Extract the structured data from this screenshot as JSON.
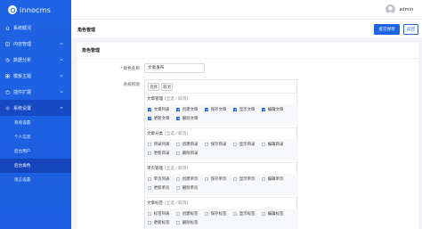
{
  "brand": {
    "name": "innocms"
  },
  "sidebar": {
    "items": [
      {
        "label": "系统概况",
        "icon": "home-icon",
        "has_children": false
      },
      {
        "label": "内容管理",
        "icon": "content-icon",
        "has_children": true
      },
      {
        "label": "数据分析",
        "icon": "chart-icon",
        "has_children": true
      },
      {
        "label": "模板主题",
        "icon": "theme-icon",
        "has_children": true
      },
      {
        "label": "插件扩展",
        "icon": "plugin-icon",
        "has_children": true
      },
      {
        "label": "系统设置",
        "icon": "gear-icon",
        "has_children": true,
        "expanded": true
      }
    ],
    "subitems": [
      {
        "label": "系统设置"
      },
      {
        "label": "个人信息"
      },
      {
        "label": "后台用户"
      },
      {
        "label": "后台角色",
        "active": true
      },
      {
        "label": "语言设置"
      }
    ]
  },
  "topbar": {
    "user": "admin"
  },
  "header": {
    "title": "角色管理",
    "save_label": "提交保存",
    "back_label": "返回"
  },
  "form": {
    "card_title": "角色管理",
    "name_label": "角色名称",
    "name_required": "*",
    "name_value": "文章发布",
    "perm_label": "系统权限",
    "select_all": "选择",
    "cancel_all": "取消",
    "groups": [
      {
        "title": "文章管理",
        "links": "[全选 / 取消]",
        "perms": [
          {
            "label": "文章列表",
            "checked": true
          },
          {
            "label": "创建文章",
            "checked": true
          },
          {
            "label": "保存文章",
            "checked": true
          },
          {
            "label": "显示文章",
            "checked": true
          },
          {
            "label": "编辑文章",
            "checked": true
          },
          {
            "label": "更新文章",
            "checked": true
          },
          {
            "label": "删除文章",
            "checked": true
          }
        ]
      },
      {
        "title": "文章分类",
        "links": "[全选 / 取消]",
        "perms": [
          {
            "label": "目录列表",
            "checked": false
          },
          {
            "label": "创建目录",
            "checked": false
          },
          {
            "label": "保存目录",
            "checked": false
          },
          {
            "label": "显示目录",
            "checked": false
          },
          {
            "label": "编辑目录",
            "checked": false
          },
          {
            "label": "更新目录",
            "checked": false
          },
          {
            "label": "删除目录",
            "checked": false
          }
        ]
      },
      {
        "title": "单页管理",
        "links": "[全选 / 取消]",
        "perms": [
          {
            "label": "单页列表",
            "checked": false
          },
          {
            "label": "创建单页",
            "checked": false
          },
          {
            "label": "保存单页",
            "checked": false
          },
          {
            "label": "显示单页",
            "checked": false
          },
          {
            "label": "编辑单页",
            "checked": false
          },
          {
            "label": "更新单页",
            "checked": false
          },
          {
            "label": "删除单页",
            "checked": false
          }
        ]
      },
      {
        "title": "文章标签",
        "links": "[全选 / 取消]",
        "perms": [
          {
            "label": "标签列表",
            "checked": false
          },
          {
            "label": "创建标签",
            "checked": false
          },
          {
            "label": "保存标签",
            "checked": false
          },
          {
            "label": "显示标签",
            "checked": false
          },
          {
            "label": "编辑标签",
            "checked": false
          },
          {
            "label": "更新标签",
            "checked": false
          },
          {
            "label": "删除标签",
            "checked": false
          }
        ]
      }
    ]
  },
  "colors": {
    "primary": "#1e63e3",
    "sidebar": "#1b5fe0",
    "active_sub": "#1545bd"
  }
}
